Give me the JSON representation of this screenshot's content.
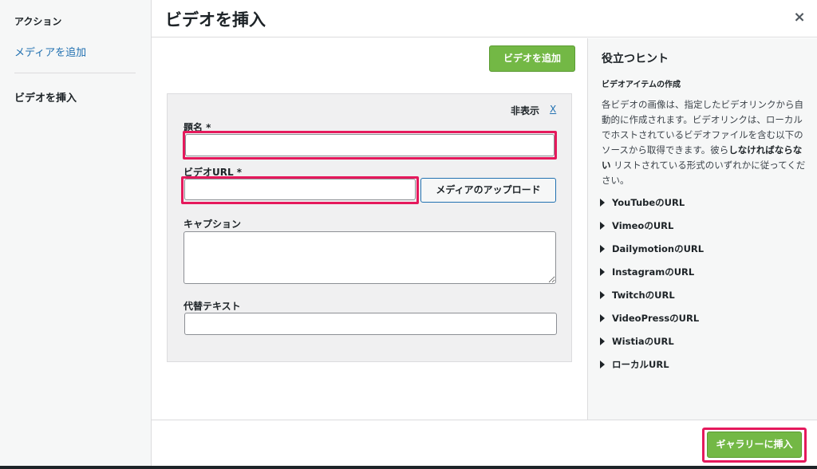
{
  "sidebar": {
    "heading": "アクション",
    "add_media_link": "メディアを追加",
    "current_item": "ビデオを挿入"
  },
  "modal": {
    "title": "ビデオを挿入",
    "close_icon": "×"
  },
  "toolbar": {
    "add_video_label": "ビデオを追加"
  },
  "form": {
    "hide_label": "非表示",
    "hide_x": "X",
    "title_label": "題名 *",
    "title_value": "",
    "video_url_label": "ビデオURL *",
    "video_url_value": "",
    "upload_button": "メディアのアップロード",
    "caption_label": "キャプション",
    "caption_value": "",
    "alt_label": "代替テキスト",
    "alt_value": ""
  },
  "hints": {
    "title": "役立つヒント",
    "subtitle": "ビデオアイテムの作成",
    "text_before": "各ビデオの画像は、指定したビデオリンクから自動的に作成されます。ビデオリンクは、ローカルでホストされているビデオファイルを含む以下のソースから取得できます。彼ら",
    "text_bold": "しなければならない",
    "text_after": " リストされている形式のいずれかに従ってください。",
    "items": [
      "YouTubeのURL",
      "VimeoのURL",
      "DailymotionのURL",
      "InstagramのURL",
      "TwitchのURL",
      "VideoPressのURL",
      "WistiaのURL",
      "ローカルURL"
    ]
  },
  "footer": {
    "insert_gallery_label": "ギャラリーに挿入"
  },
  "colors": {
    "accent_green": "#73b845",
    "highlight_pink": "#e5195c",
    "link_blue": "#2271b1"
  }
}
